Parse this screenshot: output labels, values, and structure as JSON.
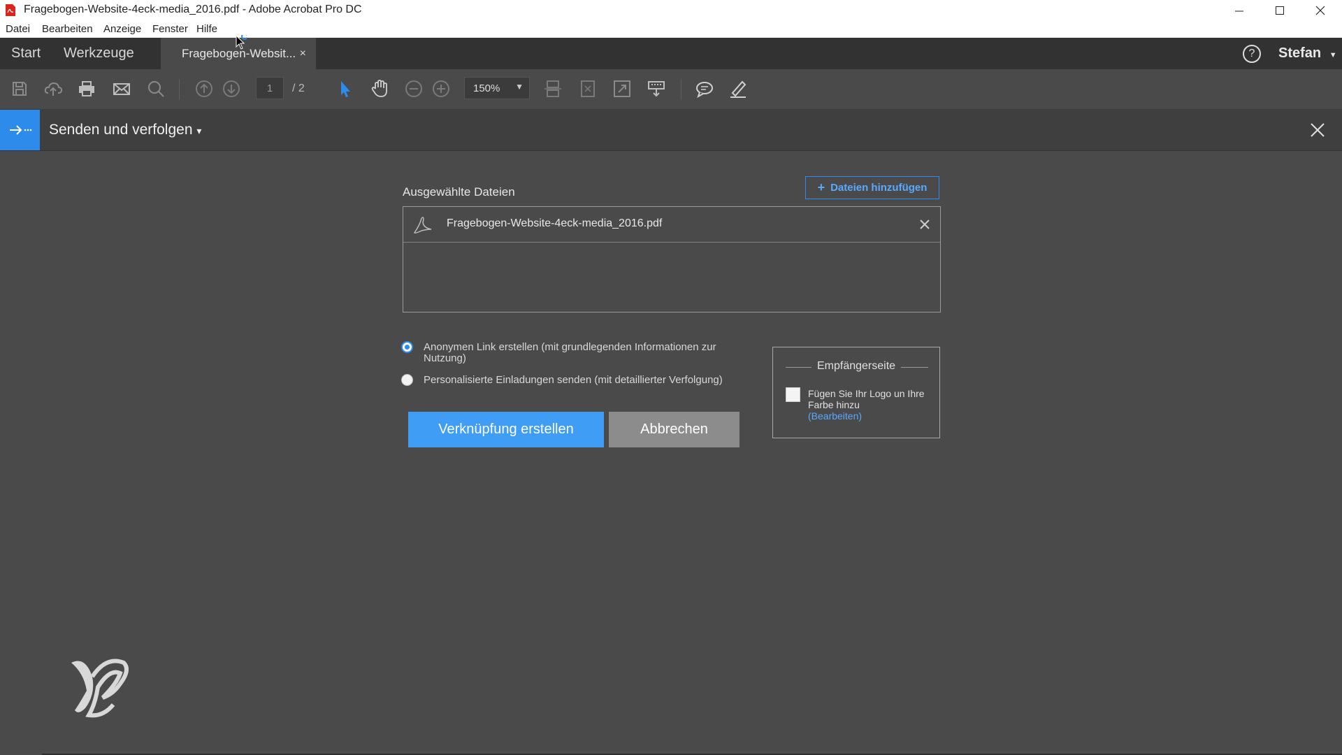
{
  "window": {
    "title": "Fragebogen-Website-4eck-media_2016.pdf - Adobe Acrobat Pro DC"
  },
  "menu": {
    "items": [
      "Datei",
      "Bearbeiten",
      "Anzeige",
      "Fenster",
      "Hilfe"
    ]
  },
  "tabs": {
    "start": "Start",
    "werkzeuge": "Werkzeuge",
    "document": "Fragebogen-Websit...",
    "close": "×"
  },
  "account": {
    "user": "Stefan",
    "help": "?"
  },
  "toolbar": {
    "page_current": "1",
    "page_total": "/ 2",
    "zoom": "150%"
  },
  "panel": {
    "title": "Senden und verfolgen",
    "title_arrow": "▾"
  },
  "files": {
    "label": "Ausgewählte Dateien",
    "add_button": "Dateien hinzufügen",
    "items": [
      "Fragebogen-Website-4eck-media_2016.pdf"
    ]
  },
  "options": {
    "anonymous": "Anonymen Link erstellen (mit grundlegenden Informationen zur Nutzung)",
    "personalized": "Personalisierte Einladungen senden (mit detaillierter Verfolgung)",
    "selected": "anonymous"
  },
  "actions": {
    "create": "Verknüpfung erstellen",
    "cancel": "Abbrechen"
  },
  "recipient": {
    "title": "Empfängerseite",
    "checkbox_label": "Fügen Sie Ihr Logo un Ihre Farbe hinzu",
    "edit_link": "(Bearbeiten)"
  },
  "colors": {
    "accent": "#2d8ceb",
    "background": "#4a4a4a",
    "tabbar": "#323232"
  }
}
